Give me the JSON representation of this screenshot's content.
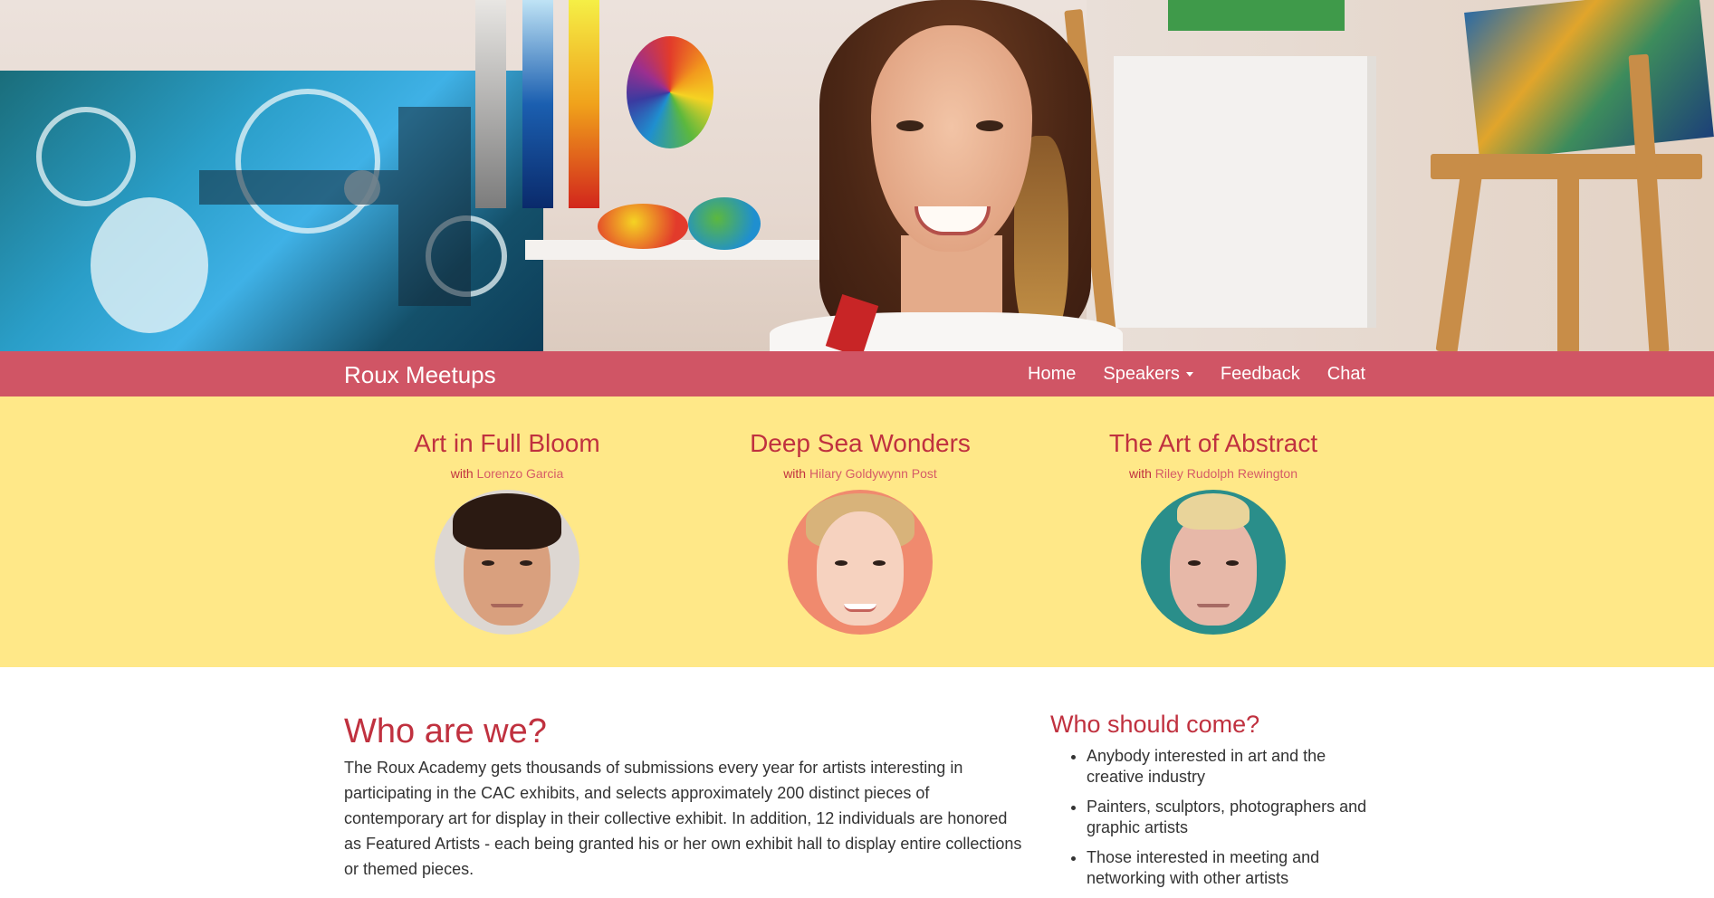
{
  "brand": {
    "name": "Roux Meetups"
  },
  "nav": {
    "items": [
      {
        "label": "Home"
      },
      {
        "label": "Speakers",
        "dropdown": true
      },
      {
        "label": "Feedback"
      },
      {
        "label": "Chat"
      }
    ]
  },
  "featured": {
    "with_prefix": "with",
    "artists": [
      {
        "title": "Art in Full Bloom",
        "speaker": "Lorenzo Garcia"
      },
      {
        "title": "Deep Sea Wonders",
        "speaker": "Hilary Goldywynn Post"
      },
      {
        "title": "The Art of Abstract",
        "speaker": "Riley Rudolph Rewington"
      }
    ]
  },
  "about": {
    "heading": "Who are we?",
    "body": "The Roux Academy gets thousands of submissions every year for artists interesting in participating in the CAC exhibits, and selects approximately 200 distinct pieces of contemporary art for display in their collective exhibit. In addition, 12 individuals are honored as Featured Artists - each being granted his or her own exhibit hall to display entire collections or themed pieces."
  },
  "audience": {
    "heading": "Who should come?",
    "items": [
      "Anybody interested in art and the creative industry",
      "Painters, sculptors, photographers and graphic artists",
      "Those interested in meeting and networking with other artists"
    ]
  },
  "colors": {
    "navbar": "#d05565",
    "featured_bg": "#ffe888",
    "accent": "#c0313f"
  }
}
